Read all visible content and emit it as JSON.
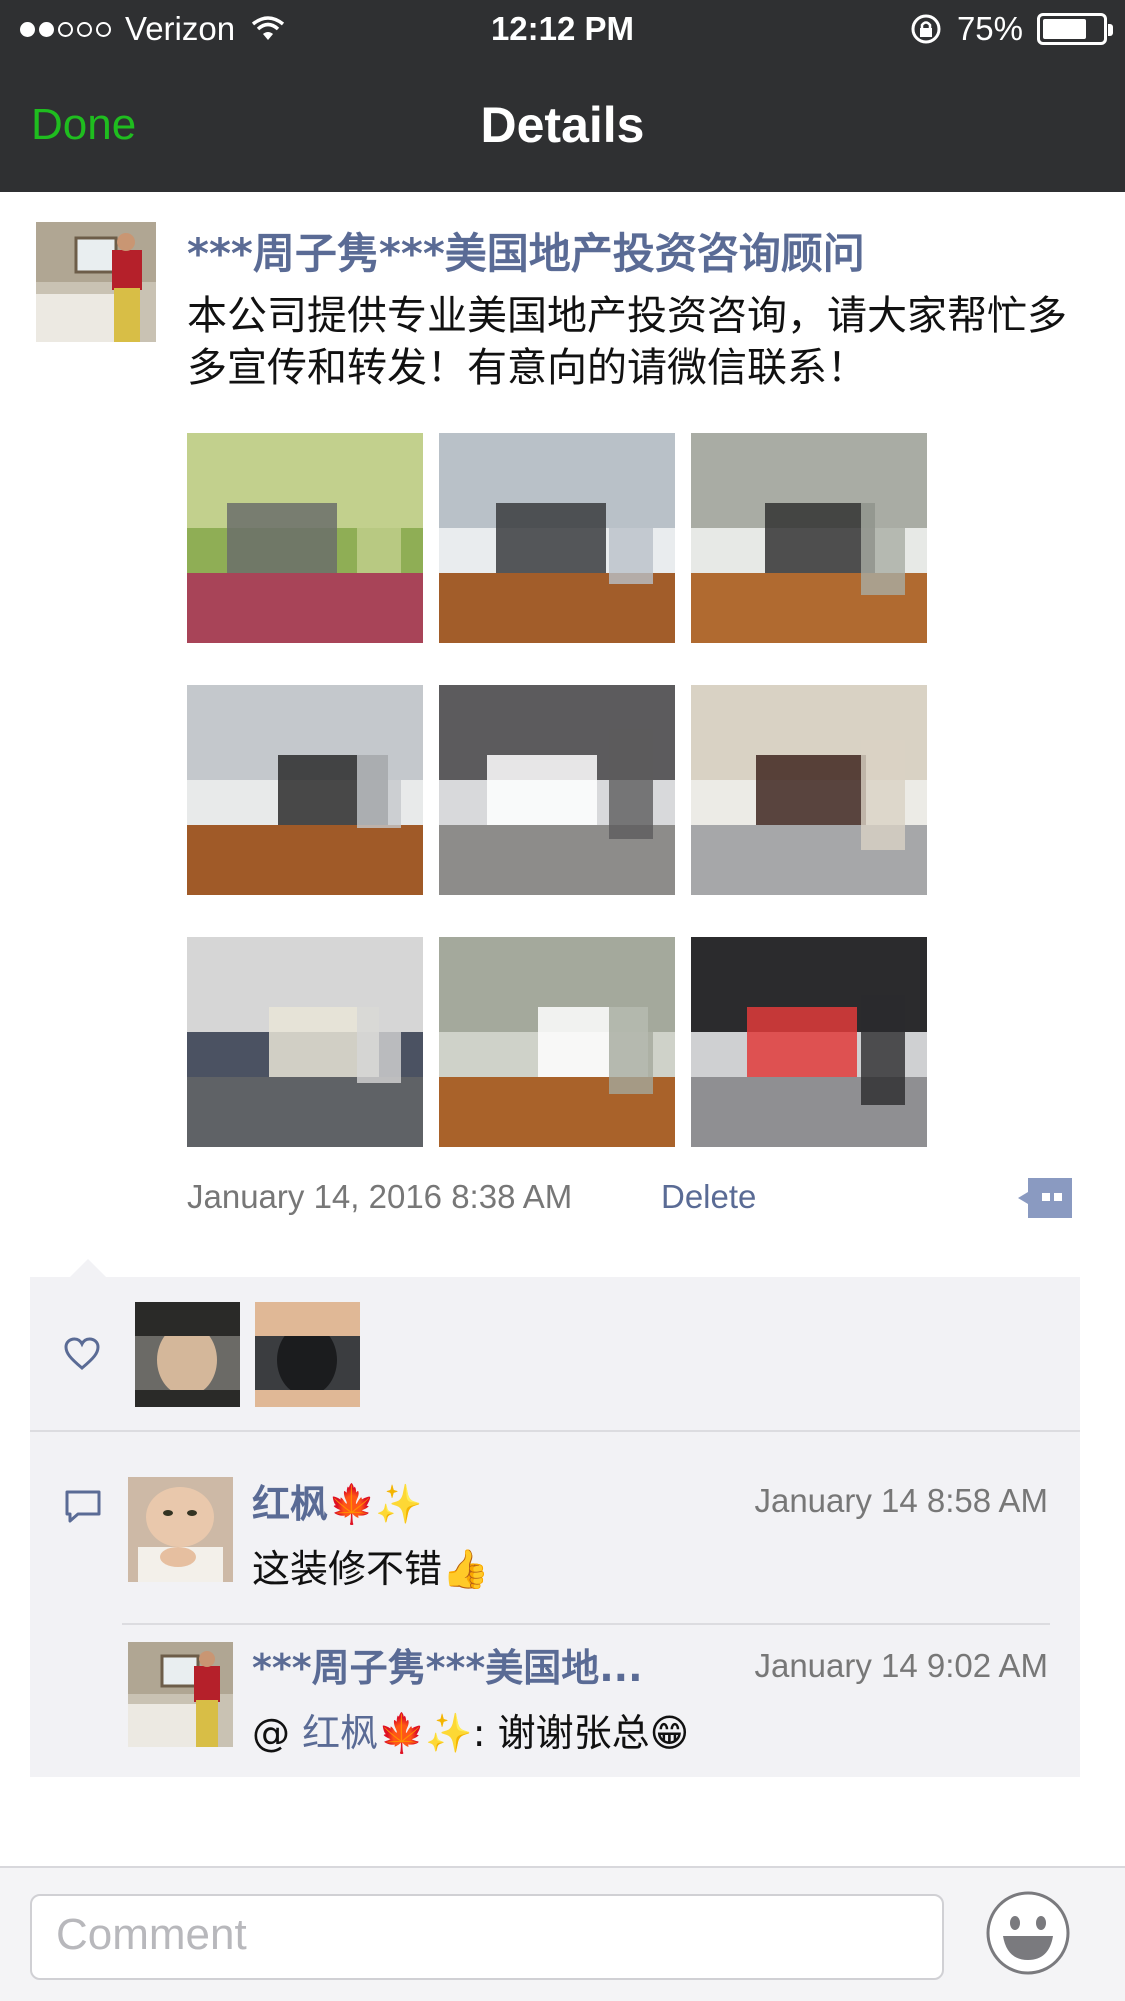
{
  "status_bar": {
    "carrier": "Verizon",
    "time": "12:12 PM",
    "battery": "75%",
    "battery_level": 0.75,
    "signal_bars_filled": 2,
    "signal_bars_total": 5
  },
  "nav": {
    "done_label": "Done",
    "title": "Details"
  },
  "post": {
    "author": "***周子隽***美国地产投资咨询顾问",
    "text": "本公司提供专业美国地产投资咨询，请大家帮忙多多宣传和转发！有意向的请微信联系！",
    "timestamp": "January 14, 2016 8:38 AM",
    "delete_label": "Delete",
    "photos": [
      {
        "icon": "house-exterior-photo",
        "colors": [
          "#8fae55",
          "#c2d08d",
          "#6b6e6b",
          "#a84458"
        ]
      },
      {
        "icon": "kitchen-photo",
        "colors": [
          "#e9ecee",
          "#b9c1c8",
          "#3a3c3e",
          "#a25d2a"
        ]
      },
      {
        "icon": "kitchen-island-photo",
        "colors": [
          "#e7e9e6",
          "#a9aca4",
          "#333",
          "#b06a30"
        ]
      },
      {
        "icon": "kitchen-stools-photo",
        "colors": [
          "#e8eaea",
          "#c4c8cc",
          "#2b2b2b",
          "#a05a28"
        ]
      },
      {
        "icon": "bathroom-tub-photo",
        "colors": [
          "#d8d9db",
          "#5c5b5d",
          "#ffffff",
          "#8d8c8a"
        ]
      },
      {
        "icon": "bathroom-vanity-photo",
        "colors": [
          "#ecebe6",
          "#d9d2c4",
          "#3f2720",
          "#a6a7a9"
        ]
      },
      {
        "icon": "bathroom-sink-photo",
        "colors": [
          "#4b5262",
          "#d6d6d6",
          "#e9e5d7",
          "#5f6266"
        ]
      },
      {
        "icon": "living-room-fireplace-photo",
        "colors": [
          "#cfd2c9",
          "#a4a99c",
          "#ffffff",
          "#a9622a"
        ]
      },
      {
        "icon": "walk-in-closet-photo",
        "colors": [
          "#cfd0d2",
          "#2b2b2d",
          "#e03b3b",
          "#8f8f92"
        ]
      }
    ]
  },
  "likes": {
    "avatars": [
      {
        "icon": "liker-avatar-1",
        "colors": [
          "#6b6a66",
          "#2a2a28",
          "#d4b79a"
        ]
      },
      {
        "icon": "liker-avatar-2",
        "colors": [
          "#3b3d40",
          "#e0b896",
          "#1b1c1e"
        ]
      }
    ]
  },
  "comments": [
    {
      "author": "红枫",
      "author_emoji": "🍁✨",
      "time": "January 14 8:58 AM",
      "text": "这装修不错",
      "text_emoji": "👍"
    },
    {
      "author": "***周子隽***美国地...",
      "time": "January 14 9:02 AM",
      "mention_prefix": "@ ",
      "mention": "红枫",
      "mention_emoji": "🍁✨",
      "text": ": 谢谢张总",
      "text_emoji": "😁"
    }
  ],
  "composer": {
    "placeholder": "Comment"
  },
  "colors": {
    "nav_bg": "#2f3032",
    "done_green": "#1fbd1f",
    "link_blue": "#5a6b95",
    "feedback_bg": "#f2f2f5"
  }
}
